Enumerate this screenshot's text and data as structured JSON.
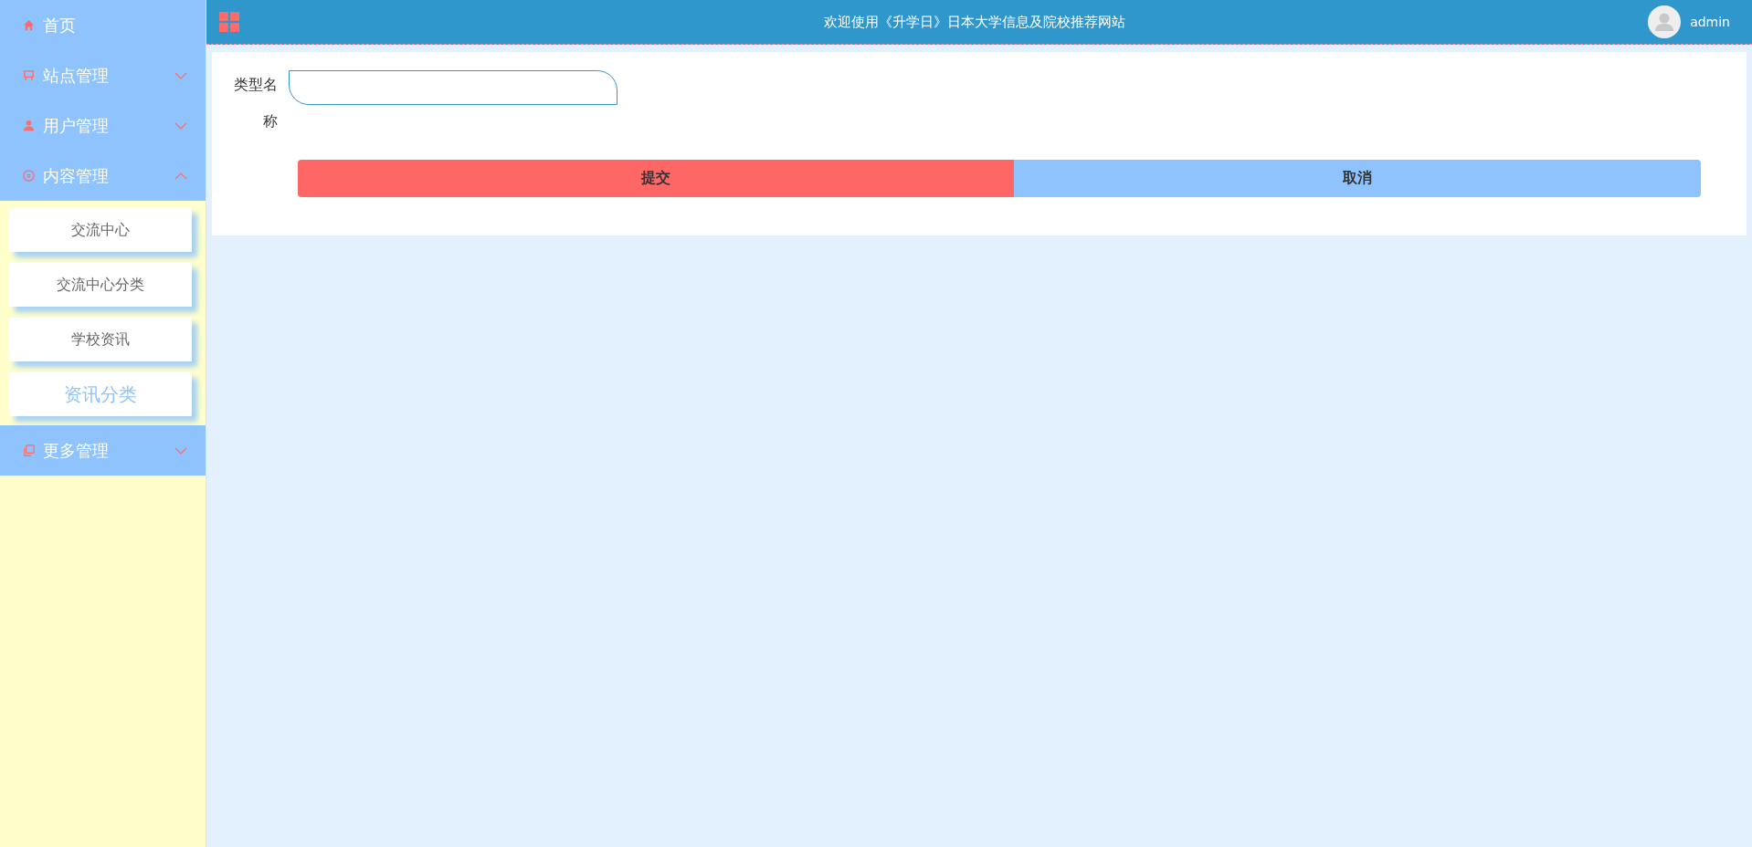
{
  "header": {
    "title": "欢迎使用《升学日》日本大学信息及院校推荐网站",
    "user": "admin"
  },
  "sidebar": {
    "items": [
      {
        "label": "首页",
        "kind": "link"
      },
      {
        "label": "站点管理",
        "kind": "group",
        "expanded": false
      },
      {
        "label": "用户管理",
        "kind": "group",
        "expanded": false
      },
      {
        "label": "内容管理",
        "kind": "group",
        "expanded": true,
        "children": [
          {
            "label": "交流中心",
            "selected": false
          },
          {
            "label": "交流中心分类",
            "selected": false
          },
          {
            "label": "学校资讯",
            "selected": false
          },
          {
            "label": "资讯分类",
            "selected": true
          }
        ]
      },
      {
        "label": "更多管理",
        "kind": "group",
        "expanded": false
      }
    ]
  },
  "form": {
    "fields": [
      {
        "label": "类型名称"
      }
    ],
    "buttons": [
      {
        "label": "提交",
        "kind": "primary"
      },
      {
        "label": "取消",
        "kind": "secondary"
      }
    ]
  }
}
